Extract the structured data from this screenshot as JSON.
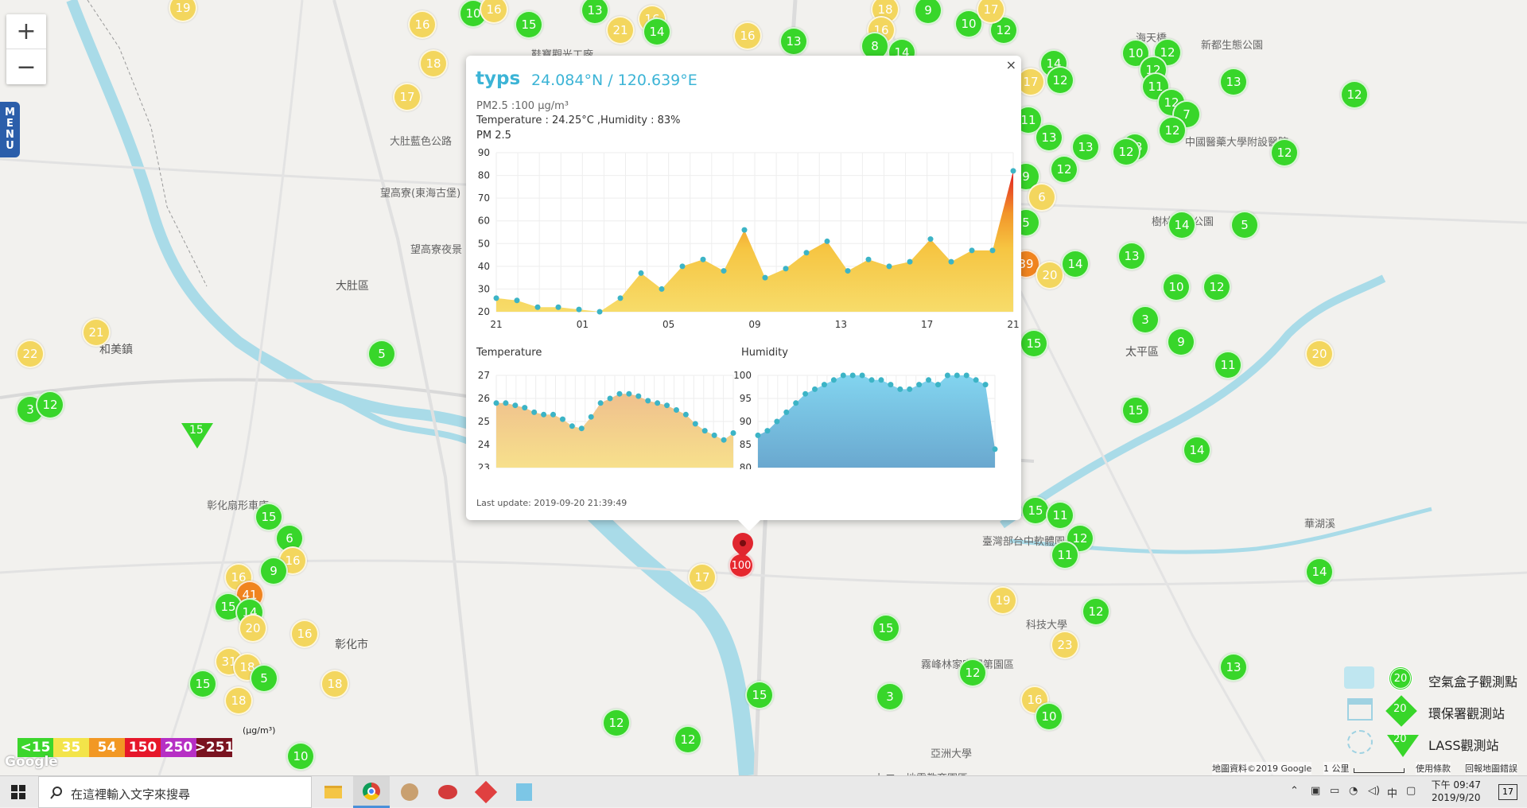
{
  "map": {
    "zoom_in": "+",
    "zoom_out": "−",
    "menu": [
      "M",
      "E",
      "N",
      "U"
    ],
    "places": [
      {
        "t": "大肚藍色公路",
        "x": 490,
        "y": 167
      },
      {
        "t": "望高寮(東海古堡)",
        "x": 478,
        "y": 232
      },
      {
        "t": "望高寮夜景",
        "x": 516,
        "y": 303
      },
      {
        "t": "大肚區",
        "x": 422,
        "y": 349,
        "big": true
      },
      {
        "t": "和美鎮",
        "x": 125,
        "y": 429,
        "big": true
      },
      {
        "t": "鞋寶觀光工廠",
        "x": 668,
        "y": 58
      },
      {
        "t": "海天橋",
        "x": 1428,
        "y": 37
      },
      {
        "t": "新都生態公園",
        "x": 1510,
        "y": 46
      },
      {
        "t": "中國醫藥大學附設醫院",
        "x": 1490,
        "y": 168
      },
      {
        "t": "太平區",
        "x": 1415,
        "y": 432,
        "big": true
      },
      {
        "t": "彰化扇形車庫",
        "x": 260,
        "y": 625
      },
      {
        "t": "彰化市",
        "x": 421,
        "y": 800,
        "big": true
      },
      {
        "t": "亞洲大學",
        "x": 1170,
        "y": 937
      },
      {
        "t": "霧峰林家宮保第園區",
        "x": 1158,
        "y": 825
      },
      {
        "t": "華湖溪",
        "x": 1640,
        "y": 648
      },
      {
        "t": "樹林森林公園",
        "x": 1448,
        "y": 268
      },
      {
        "t": "九二一地震教育園區",
        "x": 1100,
        "y": 968
      },
      {
        "t": "臺灣部台中軟體園區",
        "x": 1235,
        "y": 670
      },
      {
        "t": "科技大學",
        "x": 1290,
        "y": 775
      }
    ],
    "markers": [
      {
        "v": "19",
        "c": "y",
        "x": 230,
        "y": 10
      },
      {
        "v": "16",
        "c": "y",
        "x": 531,
        "y": 31
      },
      {
        "v": "10",
        "c": "g",
        "x": 595,
        "y": 17
      },
      {
        "v": "16",
        "c": "y",
        "x": 621,
        "y": 12
      },
      {
        "v": "15",
        "c": "g",
        "x": 665,
        "y": 31
      },
      {
        "v": "13",
        "c": "g",
        "x": 748,
        "y": 13
      },
      {
        "v": "21",
        "c": "y",
        "x": 780,
        "y": 38
      },
      {
        "v": "16",
        "c": "y",
        "x": 820,
        "y": 24
      },
      {
        "v": "14",
        "c": "g",
        "x": 826,
        "y": 40
      },
      {
        "v": "16",
        "c": "y",
        "x": 940,
        "y": 45
      },
      {
        "v": "13",
        "c": "g",
        "x": 998,
        "y": 52
      },
      {
        "v": "18",
        "c": "y",
        "x": 545,
        "y": 80
      },
      {
        "v": "17",
        "c": "y",
        "x": 512,
        "y": 122
      },
      {
        "v": "18",
        "c": "y",
        "x": 1113,
        "y": 12
      },
      {
        "v": "9",
        "c": "g",
        "x": 1167,
        "y": 13
      },
      {
        "v": "16",
        "c": "y",
        "x": 1108,
        "y": 38
      },
      {
        "v": "8",
        "c": "g",
        "x": 1100,
        "y": 58
      },
      {
        "v": "14",
        "c": "g",
        "x": 1134,
        "y": 66
      },
      {
        "v": "10",
        "c": "g",
        "x": 1218,
        "y": 30
      },
      {
        "v": "12",
        "c": "g",
        "x": 1262,
        "y": 38
      },
      {
        "v": "17",
        "c": "y",
        "x": 1246,
        "y": 12
      },
      {
        "v": "14",
        "c": "g",
        "x": 1325,
        "y": 80
      },
      {
        "v": "17",
        "c": "y",
        "x": 1296,
        "y": 103
      },
      {
        "v": "12",
        "c": "g",
        "x": 1333,
        "y": 101
      },
      {
        "v": "11",
        "c": "g",
        "x": 1293,
        "y": 151
      },
      {
        "v": "13",
        "c": "g",
        "x": 1319,
        "y": 173
      },
      {
        "v": "13",
        "c": "g",
        "x": 1365,
        "y": 185
      },
      {
        "v": "12",
        "c": "g",
        "x": 1338,
        "y": 213
      },
      {
        "v": "10",
        "c": "g",
        "x": 1428,
        "y": 67
      },
      {
        "v": "12",
        "c": "g",
        "x": 1468,
        "y": 66
      },
      {
        "v": "12",
        "c": "g",
        "x": 1450,
        "y": 88
      },
      {
        "v": "11",
        "c": "g",
        "x": 1453,
        "y": 109
      },
      {
        "v": "12",
        "c": "g",
        "x": 1473,
        "y": 129
      },
      {
        "v": "7",
        "c": "g",
        "x": 1492,
        "y": 144
      },
      {
        "v": "12",
        "c": "g",
        "x": 1474,
        "y": 164
      },
      {
        "v": "13",
        "c": "g",
        "x": 1427,
        "y": 185
      },
      {
        "v": "12",
        "c": "g",
        "x": 1416,
        "y": 191
      },
      {
        "v": "13",
        "c": "g",
        "x": 1551,
        "y": 103
      },
      {
        "v": "12",
        "c": "g",
        "x": 1703,
        "y": 119
      },
      {
        "v": "12",
        "c": "g",
        "x": 1615,
        "y": 192
      },
      {
        "v": "5",
        "c": "g",
        "x": 1565,
        "y": 283
      },
      {
        "v": "14",
        "c": "g",
        "x": 1486,
        "y": 283
      },
      {
        "v": "9",
        "c": "g",
        "x": 1290,
        "y": 222
      },
      {
        "v": "6",
        "c": "y",
        "x": 1310,
        "y": 248
      },
      {
        "v": "5",
        "c": "g",
        "x": 1290,
        "y": 280
      },
      {
        "v": "39",
        "c": "o",
        "x": 1290,
        "y": 332
      },
      {
        "v": "20",
        "c": "y",
        "x": 1320,
        "y": 346
      },
      {
        "v": "14",
        "c": "g",
        "x": 1352,
        "y": 332
      },
      {
        "v": "13",
        "c": "g",
        "x": 1423,
        "y": 322
      },
      {
        "v": "10",
        "c": "g",
        "x": 1479,
        "y": 361
      },
      {
        "v": "12",
        "c": "g",
        "x": 1530,
        "y": 361
      },
      {
        "v": "3",
        "c": "g",
        "x": 1440,
        "y": 402
      },
      {
        "v": "9",
        "c": "g",
        "x": 1485,
        "y": 430
      },
      {
        "v": "15",
        "c": "g",
        "x": 1300,
        "y": 432
      },
      {
        "v": "11",
        "c": "g",
        "x": 1544,
        "y": 459
      },
      {
        "v": "20",
        "c": "y",
        "x": 1659,
        "y": 445
      },
      {
        "v": "15",
        "c": "g",
        "x": 1428,
        "y": 516
      },
      {
        "v": "14",
        "c": "g",
        "x": 1505,
        "y": 566
      },
      {
        "v": "15",
        "c": "g",
        "x": 1302,
        "y": 642
      },
      {
        "v": "11",
        "c": "g",
        "x": 1333,
        "y": 648
      },
      {
        "v": "12",
        "c": "g",
        "x": 1358,
        "y": 677
      },
      {
        "v": "11",
        "c": "g",
        "x": 1339,
        "y": 698
      },
      {
        "v": "12",
        "c": "g",
        "x": 1378,
        "y": 769
      },
      {
        "v": "14",
        "c": "g",
        "x": 1659,
        "y": 719
      },
      {
        "v": "13",
        "c": "g",
        "x": 1551,
        "y": 839
      },
      {
        "v": "19",
        "c": "y",
        "x": 1261,
        "y": 755
      },
      {
        "v": "23",
        "c": "y",
        "x": 1339,
        "y": 811
      },
      {
        "v": "15",
        "c": "g",
        "x": 1114,
        "y": 790
      },
      {
        "v": "12",
        "c": "g",
        "x": 1223,
        "y": 846
      },
      {
        "v": "3",
        "c": "g",
        "x": 1119,
        "y": 876
      },
      {
        "v": "16",
        "c": "y",
        "x": 1301,
        "y": 880
      },
      {
        "v": "10",
        "c": "g",
        "x": 1319,
        "y": 901
      },
      {
        "v": "17",
        "c": "y",
        "x": 883,
        "y": 726
      },
      {
        "v": "100",
        "c": "r",
        "x": 934,
        "y": 713
      },
      {
        "v": "15",
        "c": "g",
        "x": 955,
        "y": 874
      },
      {
        "v": "12",
        "c": "g",
        "x": 775,
        "y": 909
      },
      {
        "v": "12",
        "c": "g",
        "x": 865,
        "y": 930
      },
      {
        "v": "5",
        "c": "g",
        "x": 480,
        "y": 445
      },
      {
        "v": "22",
        "c": "y",
        "x": 38,
        "y": 445
      },
      {
        "v": "21",
        "c": "y",
        "x": 121,
        "y": 418
      },
      {
        "v": "3",
        "c": "g",
        "x": 38,
        "y": 515
      },
      {
        "v": "12",
        "c": "g",
        "x": 63,
        "y": 509
      },
      {
        "v": "15",
        "c": "g",
        "x": 338,
        "y": 650
      },
      {
        "v": "6",
        "c": "g",
        "x": 364,
        "y": 677
      },
      {
        "v": "16",
        "c": "y",
        "x": 368,
        "y": 705
      },
      {
        "v": "9",
        "c": "g",
        "x": 344,
        "y": 718
      },
      {
        "v": "16",
        "c": "y",
        "x": 300,
        "y": 726
      },
      {
        "v": "41",
        "c": "o",
        "x": 314,
        "y": 748
      },
      {
        "v": "15",
        "c": "g",
        "x": 287,
        "y": 763
      },
      {
        "v": "14",
        "c": "g",
        "x": 314,
        "y": 770
      },
      {
        "v": "20",
        "c": "y",
        "x": 318,
        "y": 790
      },
      {
        "v": "16",
        "c": "y",
        "x": 383,
        "y": 797
      },
      {
        "v": "31",
        "c": "y",
        "x": 288,
        "y": 832
      },
      {
        "v": "18",
        "c": "y",
        "x": 311,
        "y": 839
      },
      {
        "v": "5",
        "c": "g",
        "x": 332,
        "y": 853
      },
      {
        "v": "15",
        "c": "g",
        "x": 255,
        "y": 860
      },
      {
        "v": "18",
        "c": "y",
        "x": 300,
        "y": 881
      },
      {
        "v": "18",
        "c": "y",
        "x": 421,
        "y": 860
      },
      {
        "v": "10",
        "c": "g",
        "x": 378,
        "y": 951
      }
    ],
    "lass_marker": "15",
    "pin_label": "100"
  },
  "popup": {
    "close": "×",
    "name": "typs",
    "coords": "24.084°N / 120.639°E",
    "pm_line": "PM2.5 :100 µg/m³",
    "temp_line": "Temperature : 24.25°C ,Humidity : 83%",
    "pm_title": "PM 2.5",
    "temp_title": "Temperature",
    "hum_title": "Humidity",
    "last_update": "Last update: 2019-09-20 21:39:49"
  },
  "chart_data": [
    {
      "type": "area",
      "title": "PM 2.5",
      "x_ticks": [
        "21",
        "01",
        "05",
        "09",
        "13",
        "17",
        "21"
      ],
      "ylim": [
        20,
        90
      ],
      "y_ticks": [
        20,
        30,
        40,
        50,
        60,
        70,
        80,
        90
      ],
      "values": [
        26,
        25,
        22,
        22,
        21,
        20,
        26,
        37,
        30,
        40,
        43,
        38,
        56,
        35,
        39,
        46,
        51,
        38,
        43,
        40,
        42,
        52,
        42,
        47,
        47,
        82
      ],
      "grid": true
    },
    {
      "type": "area",
      "title": "Temperature",
      "ylim": [
        23,
        27
      ],
      "y_ticks": [
        23,
        24,
        25,
        26,
        27
      ],
      "values": [
        25.8,
        25.8,
        25.7,
        25.6,
        25.4,
        25.3,
        25.3,
        25.1,
        24.8,
        24.7,
        25.2,
        25.8,
        26.0,
        26.2,
        26.2,
        26.1,
        25.9,
        25.8,
        25.7,
        25.5,
        25.3,
        24.9,
        24.6,
        24.4,
        24.2,
        24.5
      ],
      "grid": true
    },
    {
      "type": "area",
      "title": "Humidity",
      "ylim": [
        80,
        100
      ],
      "y_ticks": [
        80,
        85,
        90,
        95,
        100
      ],
      "values": [
        87,
        88,
        90,
        92,
        94,
        96,
        97,
        98,
        99,
        100,
        100,
        100,
        99,
        99,
        98,
        97,
        97,
        98,
        99,
        98,
        100,
        100,
        100,
        99,
        98,
        84
      ],
      "grid": true
    }
  ],
  "legend": {
    "unit": "(µg/m³)",
    "scale": [
      {
        "t": "<15",
        "c": "#3cd62c"
      },
      {
        "t": "35",
        "c": "#f3e44a"
      },
      {
        "t": "54",
        "c": "#f29824"
      },
      {
        "t": "150",
        "c": "#e6172a"
      },
      {
        "t": "250",
        "c": "#b62fc4"
      },
      {
        "t": ">251",
        "c": "#7a1320"
      }
    ],
    "stations": [
      {
        "icon": "airbox-icon",
        "label": "空氣盒子觀測點",
        "v": "20"
      },
      {
        "icon": "epa-icon",
        "label": "環保署觀測站",
        "v": "20"
      },
      {
        "icon": "lass-icon",
        "label": "LASS觀測站",
        "v": "20"
      }
    ]
  },
  "footer": {
    "google": "Google",
    "mapdata": "地圖資料©2019 Google",
    "scale": "1 公里",
    "terms": "使用條款",
    "report": "回報地圖錯誤"
  },
  "taskbar": {
    "search": "在這裡輸入文字來搜尋",
    "time": "下午 09:47",
    "date": "2019/9/20",
    "ime": "中",
    "notif": "17"
  }
}
